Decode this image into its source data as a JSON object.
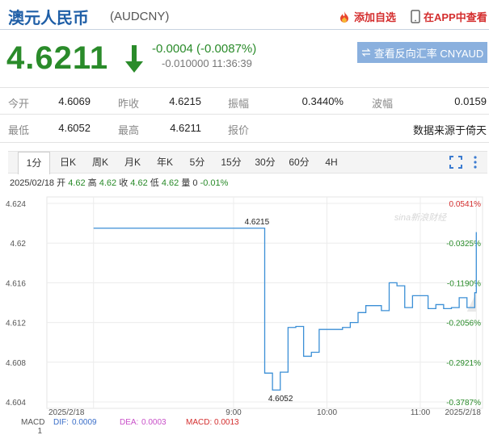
{
  "header": {
    "title": "澳元人民币",
    "code": "(AUDCNY)",
    "add_favorite": "添加自选",
    "view_in_app": "在APP中查看"
  },
  "quote": {
    "price": "4.6211",
    "change": "-0.0004 (-0.0087%)",
    "change_detail": "-0.010000 11:36:39",
    "reverse_button": "查看反向汇率 CNYAUD",
    "color_down": "#2a8b2a"
  },
  "stats": {
    "row1": [
      {
        "label": "今开",
        "value": "4.6069"
      },
      {
        "label": "昨收",
        "value": "4.6215"
      },
      {
        "label": "振幅",
        "value": "0.3440%"
      },
      {
        "label": "波幅",
        "value": "0.0159"
      }
    ],
    "row2": [
      {
        "label": "最低",
        "value": "4.6052"
      },
      {
        "label": "最高",
        "value": "4.6211"
      },
      {
        "label": "报价",
        "value": "数据来源于倚天"
      }
    ]
  },
  "tabs": [
    "1分",
    "日K",
    "周K",
    "月K",
    "年K",
    "5分",
    "15分",
    "30分",
    "60分",
    "4H"
  ],
  "active_tab": "1分",
  "info": {
    "date": "2025/02/18",
    "open_label": "开",
    "open": "4.62",
    "high_label": "高",
    "high": "4.62",
    "close_label": "收",
    "close": "4.62",
    "low_label": "低",
    "low": "4.62",
    "volume_label": "量",
    "volume": "0",
    "pct": "-0.01%"
  },
  "chart_data": {
    "type": "line",
    "series": [
      {
        "x": [
          "07:30",
          "07:45",
          "08:00",
          "08:15",
          "08:30",
          "08:45",
          "09:00",
          "09:15",
          "09:20",
          "09:25",
          "09:30",
          "09:35",
          "09:40",
          "09:45",
          "09:50",
          "09:55",
          "10:00",
          "10:05",
          "10:10",
          "10:15",
          "10:20",
          "10:25",
          "10:30",
          "10:35",
          "10:40",
          "10:45",
          "10:50",
          "10:55",
          "11:00",
          "11:05",
          "11:10",
          "11:15",
          "11:20",
          "11:25",
          "11:30",
          "11:35",
          "11:36"
        ],
        "values": [
          4.6215,
          4.6215,
          4.6215,
          4.6215,
          4.6215,
          4.6215,
          4.6215,
          4.6215,
          4.6069,
          4.6052,
          4.607,
          4.6115,
          4.6116,
          4.6086,
          4.609,
          4.6113,
          4.6113,
          4.6113,
          4.6115,
          4.612,
          4.613,
          4.6137,
          4.6137,
          4.6132,
          4.616,
          4.6157,
          4.6135,
          4.6147,
          4.6147,
          4.6134,
          4.6138,
          4.6134,
          4.6135,
          4.6145,
          4.6135,
          4.615,
          4.6211
        ]
      }
    ],
    "y_ticks_left": [
      "4.624",
      "4.62",
      "4.616",
      "4.612",
      "4.608",
      "4.604"
    ],
    "y_ticks_right": [
      "0.0541%",
      "-0.0325%",
      "-0.1190%",
      "-0.2056%",
      "-0.2921%",
      "-0.3787%"
    ],
    "x_ticks": [
      "2025/2/18",
      "9:00",
      "10:00",
      "11:00",
      "2025/2/18"
    ],
    "ylim": [
      4.604,
      4.624
    ],
    "annotations": [
      {
        "text": "4.6215",
        "x": "09:15",
        "y": 4.6215
      },
      {
        "text": "4.6052",
        "x": "09:25",
        "y": 4.6052
      }
    ],
    "watermark": "sina新浪财经",
    "prev_close": 4.6215,
    "line_color": "#3b8fd6"
  },
  "macd": {
    "label": "MACD",
    "dif_label": "DIF:",
    "dif": "0.0009",
    "dea_label": "DEA:",
    "dea": "0.0003",
    "macd_label": "MACD:",
    "macd_val": "0.0013",
    "axis_value": "1"
  }
}
